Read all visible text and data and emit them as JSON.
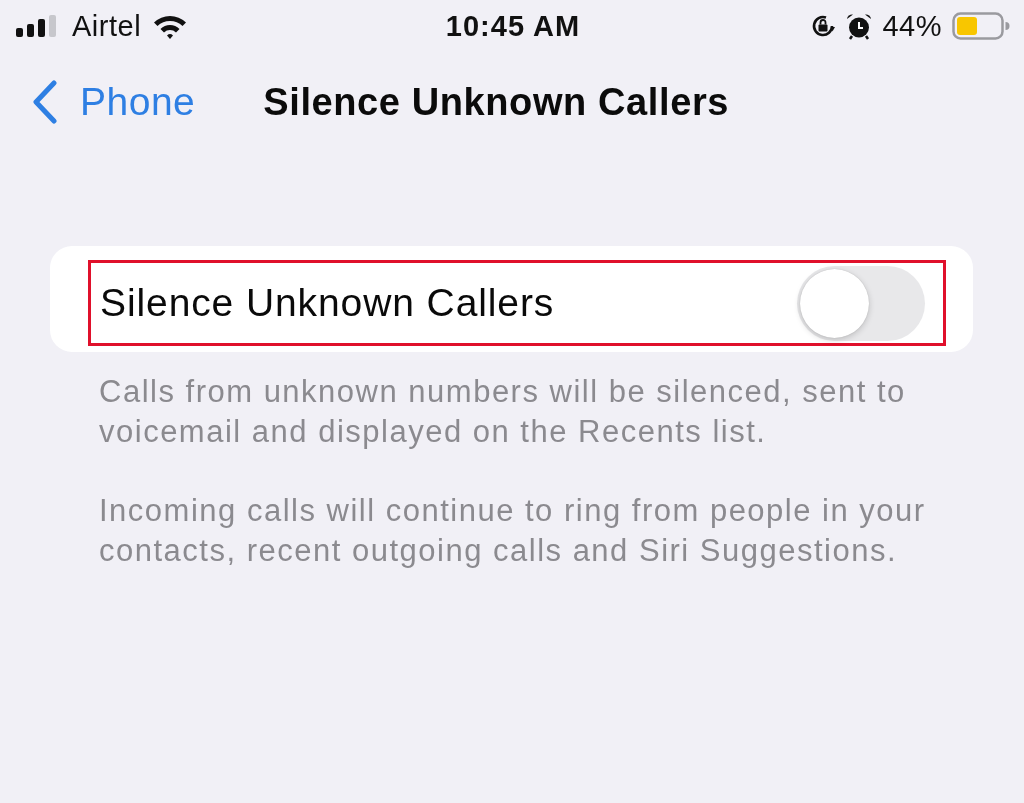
{
  "status_bar": {
    "carrier": "Airtel",
    "time": "10:45 AM",
    "battery_percent": "44%"
  },
  "nav_bar": {
    "back_label": "Phone",
    "title": "Silence Unknown Callers"
  },
  "settings_group": {
    "rows": [
      {
        "label": "Silence Unknown Callers",
        "on": false,
        "highlighted": true
      }
    ]
  },
  "footer_notes": [
    "Calls from unknown numbers will be silenced, sent to voicemail and displayed on the Recents list.",
    "Incoming calls will continue to ring from people in your contacts, recent outgoing calls and Siri Suggestions."
  ]
}
